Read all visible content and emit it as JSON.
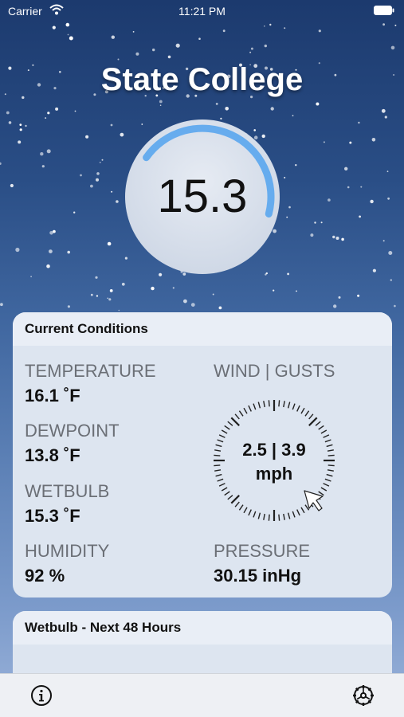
{
  "status_bar": {
    "carrier": "Carrier",
    "time": "11:21 PM",
    "wifi_icon": "wifi-icon",
    "battery_icon": "battery-full-icon"
  },
  "location": {
    "city": "State College"
  },
  "gauge": {
    "value": "15.3",
    "fraction_filled": 0.55,
    "color": "#5aa6ee"
  },
  "current_conditions": {
    "title": "Current Conditions",
    "temperature": {
      "label": "TEMPERATURE",
      "value": "16.1 ˚F"
    },
    "dewpoint": {
      "label": "DEWPOINT",
      "value": "13.8 ˚F"
    },
    "wetbulb": {
      "label": "WETBULB",
      "value": "15.3 ˚F"
    },
    "humidity": {
      "label": "HUMIDITY",
      "value": "92 %"
    },
    "wind": {
      "label": "WIND | GUSTS",
      "speeds": "2.5 | 3.9",
      "unit": "mph",
      "direction_icon": "arrow-pointer-icon"
    },
    "pressure": {
      "label": "PRESSURE",
      "value": "30.15 inHg"
    }
  },
  "forecast_card": {
    "title": "Wetbulb - Next 48 Hours"
  },
  "tab_bar": {
    "info_icon": "info-icon",
    "settings_icon": "settings-icon"
  },
  "colors": {
    "sky_top": "#1c3a6e",
    "sky_bottom": "#9bb3da",
    "card_background": "#dde5f0",
    "card_header": "#e9eef6"
  }
}
